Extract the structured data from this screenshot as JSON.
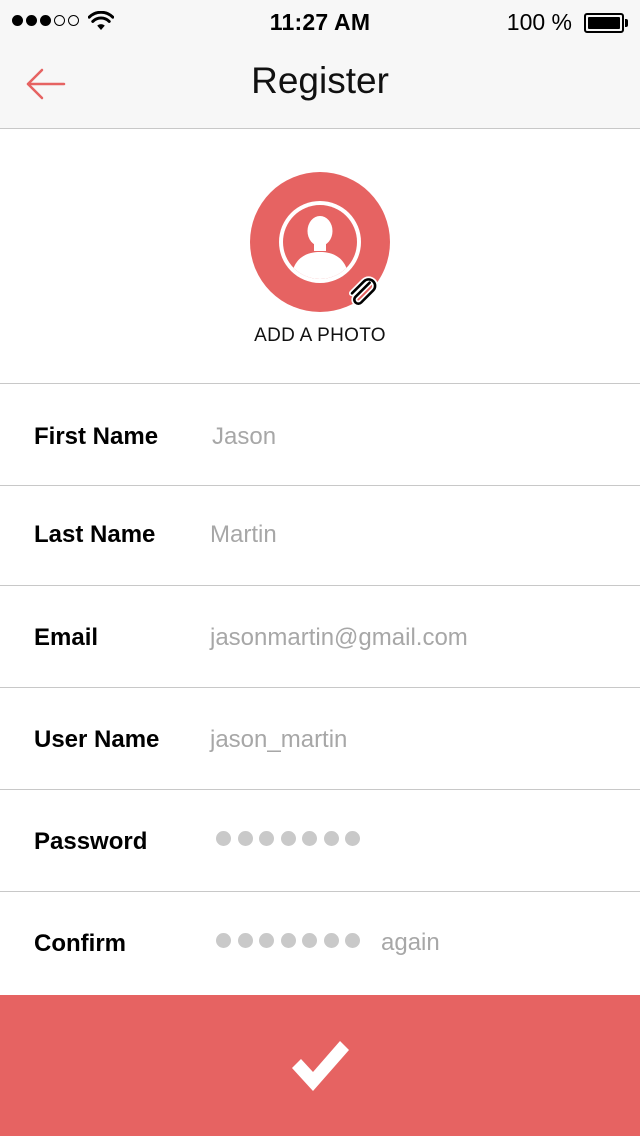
{
  "status_bar": {
    "time": "11:27 AM",
    "battery_percent": "100 %",
    "signal_bars_filled": 3,
    "signal_bars_total": 5
  },
  "nav": {
    "title": "Register",
    "back_icon": "arrow-left-icon"
  },
  "avatar": {
    "add_photo_label": "ADD A PHOTO",
    "icon": "person-silhouette-icon",
    "attach_icon": "paperclip-icon"
  },
  "form": {
    "fields": [
      {
        "label": "First Name",
        "value": "Jason"
      },
      {
        "label": "Last Name",
        "value": "Martin"
      },
      {
        "label": "Email",
        "value": "jasonmartin@gmail.com"
      },
      {
        "label": "User Name",
        "value": "jason_martin"
      },
      {
        "label": "Password",
        "masked_length": 7
      },
      {
        "label": "Confirm",
        "masked_length": 7,
        "suffix": "again"
      }
    ]
  },
  "submit": {
    "icon": "checkmark-icon"
  },
  "colors": {
    "accent": "#e66362",
    "bar_background": "#f7f7f7",
    "divider": "#c8c8c8",
    "value_text": "#a7a7a7",
    "mask_dot": "#c9c9c9"
  }
}
